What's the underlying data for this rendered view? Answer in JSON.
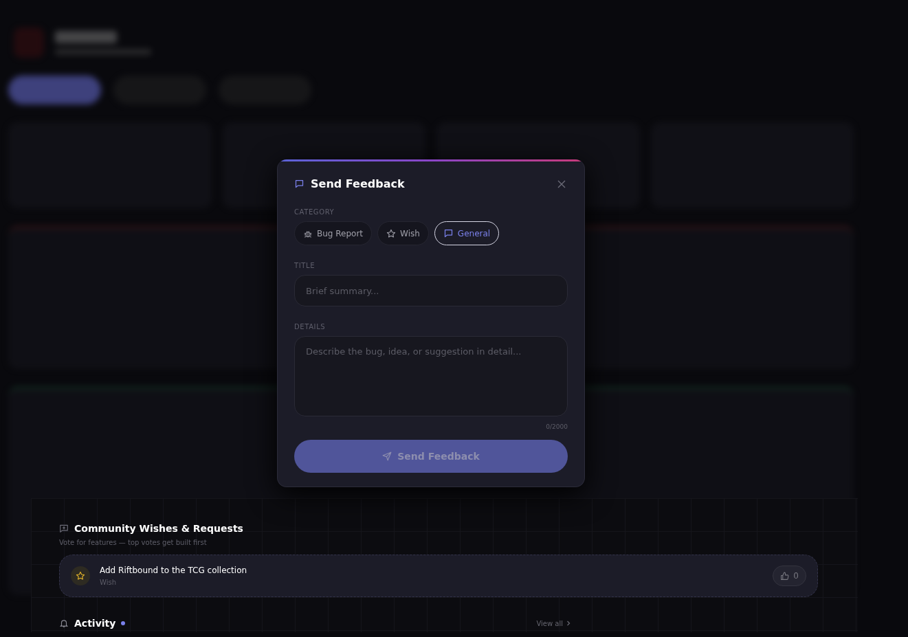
{
  "dialog": {
    "title": "Send Feedback",
    "category_label": "CATEGORY",
    "categories": [
      {
        "kind": "bug",
        "label": "Bug Report",
        "selected": false
      },
      {
        "kind": "wish",
        "label": "Wish",
        "selected": false
      },
      {
        "kind": "general",
        "label": "General",
        "selected": true
      }
    ],
    "title_label": "TITLE",
    "title_placeholder": "Brief summary...",
    "details_label": "DETAILS",
    "details_placeholder": "Describe the bug, idea, or suggestion in detail...",
    "char_count": "0/2000",
    "submit": {
      "label": "Send Feedback",
      "disabled": true
    }
  },
  "wishes": {
    "title": "Community Wishes & Requests",
    "subtitle": "Vote for features — top votes get built first",
    "items": [
      {
        "kind": "wish",
        "title": "Add Riftbound to the TCG collection",
        "category": "Wish",
        "votes": "0"
      }
    ]
  },
  "activity": {
    "title": "Activity",
    "link": "View all"
  }
}
